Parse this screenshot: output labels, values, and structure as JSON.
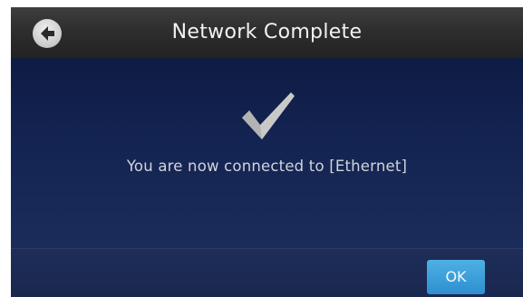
{
  "header": {
    "title": "Network Complete",
    "back_icon": "back-arrow-icon"
  },
  "content": {
    "status_icon": "checkmark-icon",
    "message": "You are now connected to [Ethernet]"
  },
  "footer": {
    "ok_label": "OK"
  },
  "colors": {
    "header_bg": "#2e2e2e",
    "content_bg": "#142452",
    "accent": "#3a9fd9",
    "checkmark": "#c8c8c8"
  }
}
